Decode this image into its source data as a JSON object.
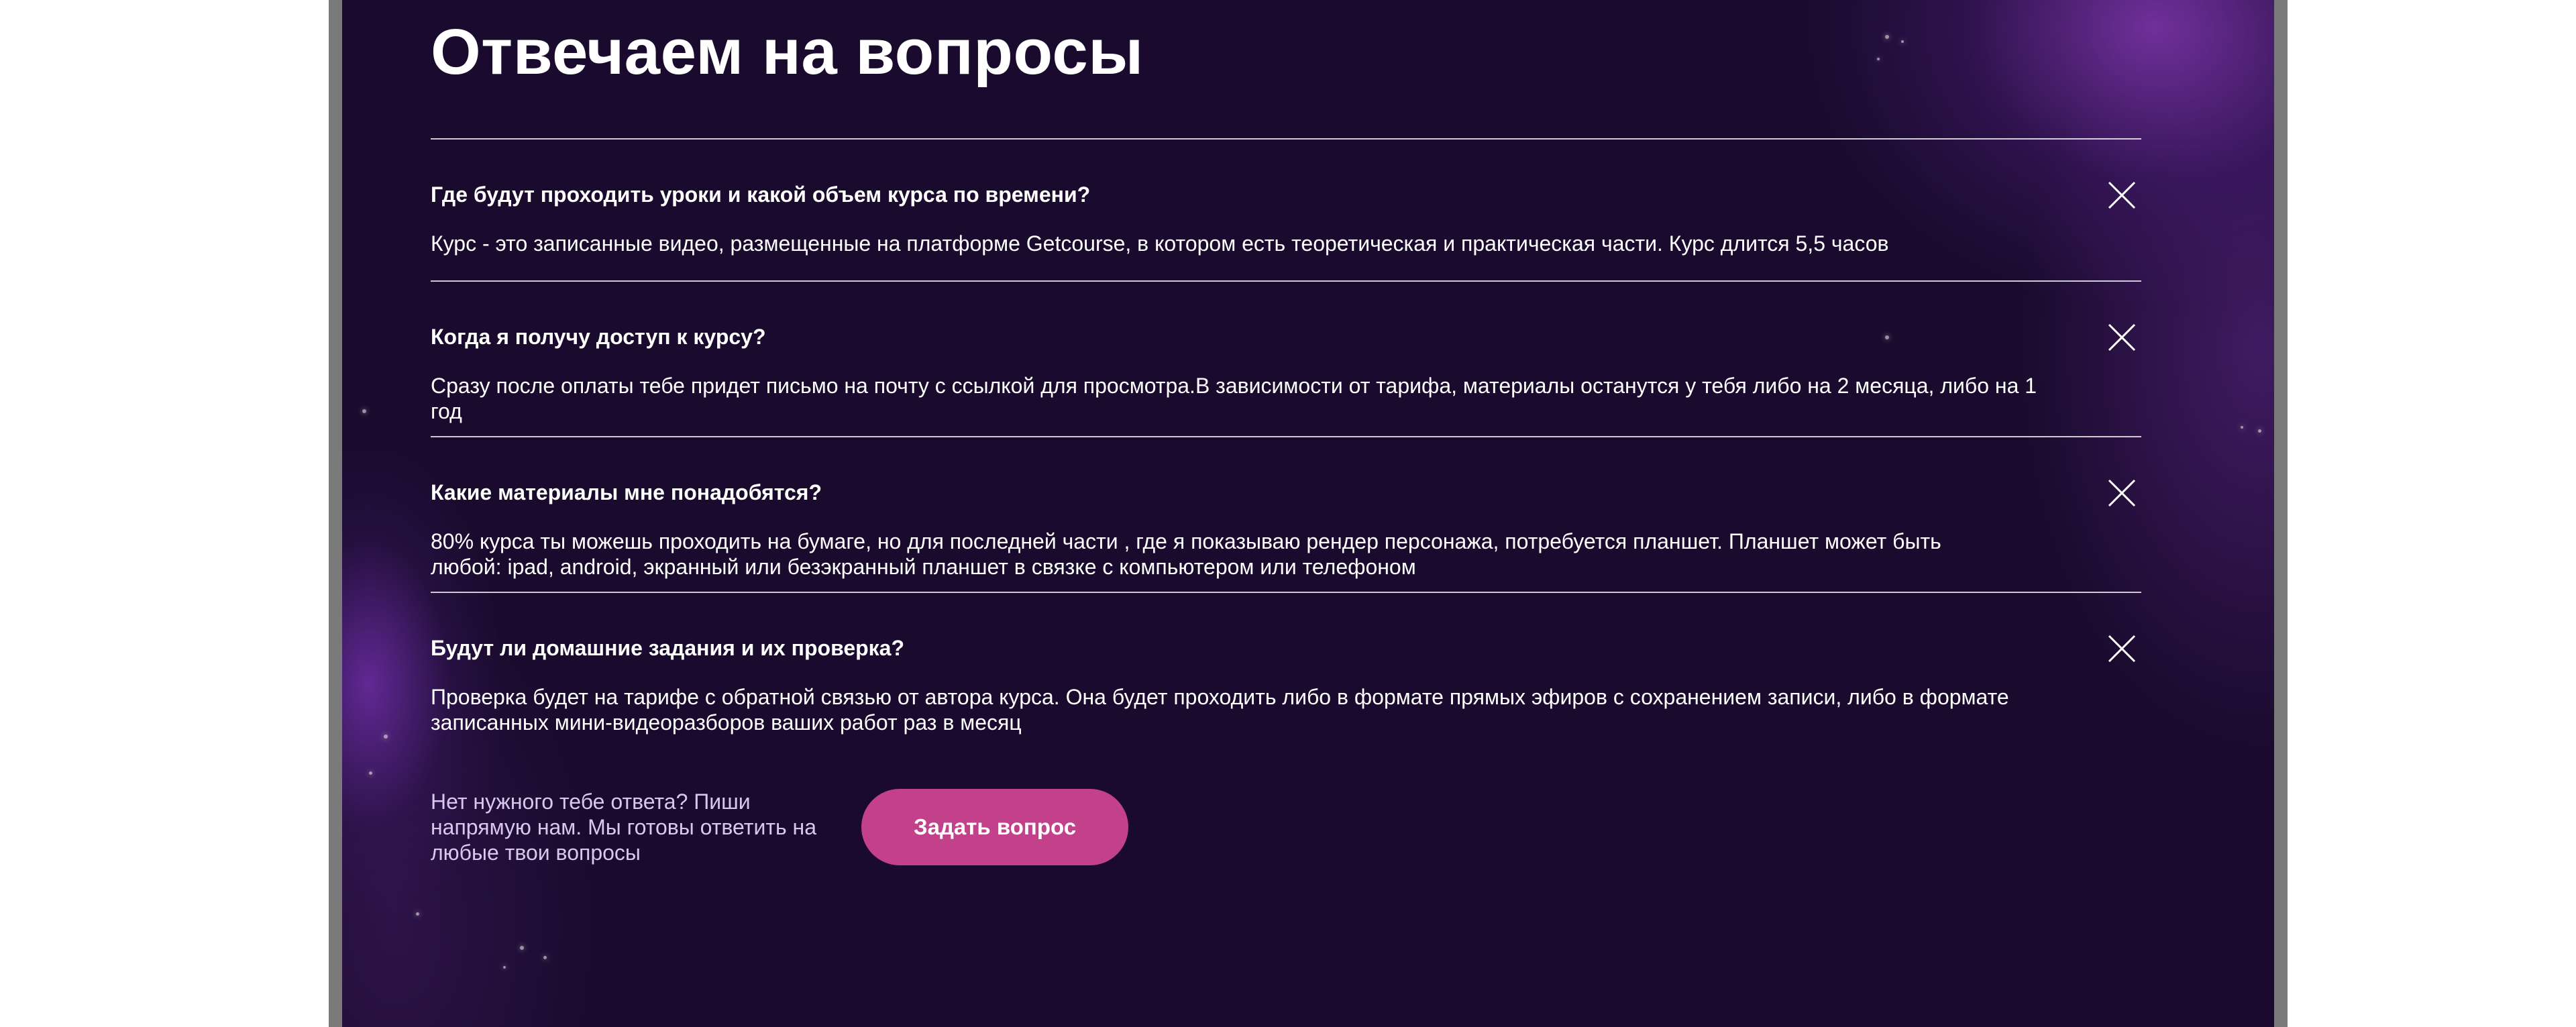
{
  "section": {
    "title": "Отвечаем на вопросы"
  },
  "faq": [
    {
      "question": "Где будут проходить уроки и какой объем курса по времени?",
      "answer": "Курс - это записанные видео, размещенные на платформе Getcourse, в котором есть теоретическая и практическая части. Курс длится 5,5 часов",
      "toggle_icon": "close-icon"
    },
    {
      "question": "Когда я получу доступ к курсу?",
      "answer": "Сразу после оплаты тебе придет письмо на почту с ссылкой для просмотра.В зависимости от тарифа, материалы останутся у тебя либо на 2 месяца, либо на 1 год",
      "toggle_icon": "close-icon"
    },
    {
      "question": "Какие материалы мне понадобятся?",
      "answer": "80% курса ты можешь проходить на бумаге, но для последней части , где я показываю рендер персонажа, потребуется планшет. Планшет может быть любой: ipad, android, экранный или безэкранный планшет в связке с компьютером или телефоном",
      "toggle_icon": "close-icon"
    },
    {
      "question": "Будут ли домашние задания и их проверка?",
      "answer": "Проверка будет на тарифе с обратной связью от автора курса. Она будет проходить либо в формате прямых эфиров с сохранением записи, либо в формате записанных мини-видеоразборов ваших работ раз в месяц",
      "toggle_icon": "close-icon"
    }
  ],
  "contact": {
    "text": "Нет нужного тебе ответа? Пиши напрямую нам. Мы готовы ответить на любые твои вопросы",
    "button_label": "Задать вопрос"
  },
  "colors": {
    "background": "#1a0b2e",
    "accent_button": "#c2418a",
    "glow": "#8c3cbe",
    "frame": "#7a7a7a"
  }
}
